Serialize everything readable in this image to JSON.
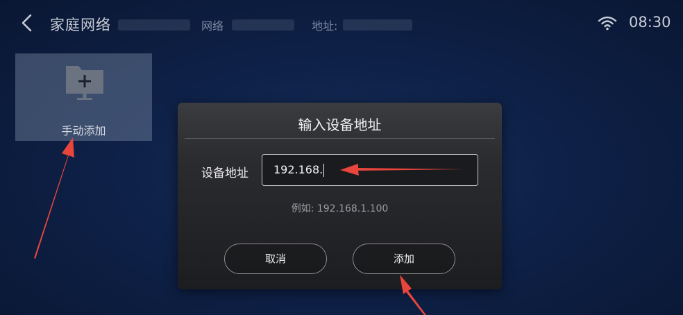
{
  "topbar": {
    "back_icon": "chevron-left-icon",
    "title": "家庭网络",
    "network_label": "网络",
    "address_label": "地址:",
    "wifi_icon": "wifi-icon",
    "time": "08:30"
  },
  "tiles": [
    {
      "label": "手动添加",
      "icon": "folder-add-icon"
    }
  ],
  "dialog": {
    "title": "输入设备地址",
    "field_label": "设备地址",
    "field_value": "192.168.",
    "hint": "例如: 192.168.1.100",
    "cancel_label": "取消",
    "add_label": "添加"
  },
  "colors": {
    "background": "#0e2148",
    "dialog_background": "#2b2c30",
    "annotation_arrow": "#e8453c"
  }
}
